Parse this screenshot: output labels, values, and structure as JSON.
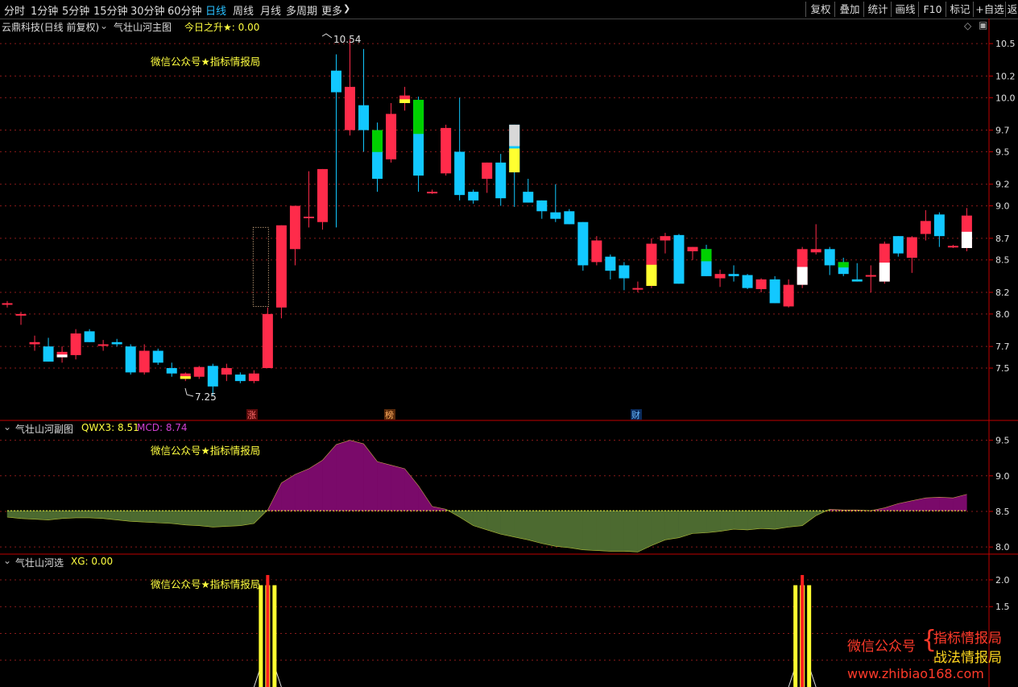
{
  "toolbar": {
    "timeframes": [
      "分时",
      "1分钟",
      "5分钟",
      "15分钟",
      "30分钟",
      "60分钟",
      "日线",
      "周线",
      "月线",
      "多周期",
      "更多"
    ],
    "active": "日线",
    "right_buttons": [
      "复权",
      "叠加",
      "统计",
      "画线",
      "F10",
      "标记",
      "+自选",
      "返"
    ]
  },
  "main_panel": {
    "stock_title": "云鼎科技(日线 前复权)",
    "indicator_name": "气壮山河主图",
    "indicator_value": "今日之升★: 0.00",
    "watermark": "微信公众号★指标情报局",
    "high_label": "10.54",
    "low_label": "7.25",
    "markers": [
      "涨",
      "榜",
      "财"
    ]
  },
  "sub_panel_1": {
    "indicator_name": "气壮山河副图",
    "qwx3": "QWX3: 8.51",
    "mcd": "MCD: 8.74",
    "watermark": "微信公众号★指标情报局"
  },
  "sub_panel_2": {
    "indicator_name": "气壮山河选",
    "xg": "XG: 0.00",
    "watermark": "微信公众号★指标情报局"
  },
  "brand_overlay": {
    "prefix": "微信公众号",
    "line1": "指标情报局",
    "line2": "战法情报局",
    "url": "www.zhibiao168.com"
  },
  "colors": {
    "up": "#ff2b4a",
    "down": "#12c8ff",
    "accent_green": "#00d000",
    "highlight_yellow": "#ffff30",
    "axis_red": "#c00000",
    "purple_area": "#7a0a6a",
    "olive_area": "#4c6a30"
  },
  "chart_data": [
    {
      "type": "candlestick",
      "title": "气壮山河主图",
      "y_axis_ticks": [
        "10.5",
        "10.2",
        "10.0",
        "9.7",
        "9.5",
        "9.2",
        "9.0",
        "8.7",
        "8.5",
        "8.2",
        "8.0",
        "7.7",
        "7.5"
      ],
      "ylim": [
        7.0,
        10.6
      ],
      "candles": [
        {
          "o": 8.1,
          "h": 8.12,
          "l": 8.06,
          "c": 8.1
        },
        {
          "o": 8.0,
          "h": 8.02,
          "l": 7.9,
          "c": 8.0
        },
        {
          "o": 7.72,
          "h": 7.8,
          "l": 7.66,
          "c": 7.74
        },
        {
          "o": 7.7,
          "h": 7.78,
          "l": 7.58,
          "c": 7.56
        },
        {
          "o": 7.6,
          "h": 7.7,
          "l": 7.55,
          "c": 7.65
        },
        {
          "o": 7.62,
          "h": 7.86,
          "l": 7.58,
          "c": 7.82
        },
        {
          "o": 7.84,
          "h": 7.86,
          "l": 7.74,
          "c": 7.74
        },
        {
          "o": 7.72,
          "h": 7.76,
          "l": 7.66,
          "c": 7.72
        },
        {
          "o": 7.74,
          "h": 7.77,
          "l": 7.7,
          "c": 7.72
        },
        {
          "o": 7.7,
          "h": 7.72,
          "l": 7.44,
          "c": 7.46
        },
        {
          "o": 7.46,
          "h": 7.72,
          "l": 7.44,
          "c": 7.66
        },
        {
          "o": 7.66,
          "h": 7.68,
          "l": 7.53,
          "c": 7.55
        },
        {
          "o": 7.5,
          "h": 7.55,
          "l": 7.42,
          "c": 7.45
        },
        {
          "o": 7.4,
          "h": 7.46,
          "l": 7.38,
          "c": 7.45
        },
        {
          "o": 7.42,
          "h": 7.52,
          "l": 7.4,
          "c": 7.51
        },
        {
          "o": 7.52,
          "h": 7.54,
          "l": 7.25,
          "c": 7.33
        },
        {
          "o": 7.44,
          "h": 7.54,
          "l": 7.38,
          "c": 7.5
        },
        {
          "o": 7.44,
          "h": 7.46,
          "l": 7.36,
          "c": 7.38
        },
        {
          "o": 7.38,
          "h": 7.48,
          "l": 7.36,
          "c": 7.45
        },
        {
          "o": 7.5,
          "h": 8.06,
          "l": 7.5,
          "c": 8.0
        },
        {
          "o": 8.06,
          "h": 8.72,
          "l": 7.96,
          "c": 8.82
        },
        {
          "o": 8.6,
          "h": 9.0,
          "l": 8.45,
          "c": 9.0
        },
        {
          "o": 8.9,
          "h": 9.32,
          "l": 8.8,
          "c": 8.9
        },
        {
          "o": 8.85,
          "h": 9.34,
          "l": 8.78,
          "c": 9.34
        },
        {
          "o": 10.25,
          "h": 10.4,
          "l": 8.8,
          "c": 10.05
        },
        {
          "o": 9.7,
          "h": 10.54,
          "l": 9.65,
          "c": 10.1
        },
        {
          "o": 9.93,
          "h": 10.45,
          "l": 9.5,
          "c": 9.7
        },
        {
          "o": 9.7,
          "h": 9.77,
          "l": 9.13,
          "c": 9.25
        },
        {
          "o": 9.43,
          "h": 9.95,
          "l": 9.4,
          "c": 9.85
        },
        {
          "o": 9.95,
          "h": 10.1,
          "l": 9.88,
          "c": 10.02
        },
        {
          "o": 9.98,
          "h": 10.01,
          "l": 9.13,
          "c": 9.28
        },
        {
          "o": 9.13,
          "h": 9.15,
          "l": 9.11,
          "c": 9.13
        },
        {
          "o": 9.3,
          "h": 9.75,
          "l": 9.28,
          "c": 9.72
        },
        {
          "o": 9.5,
          "h": 10.0,
          "l": 9.05,
          "c": 9.1
        },
        {
          "o": 9.13,
          "h": 9.15,
          "l": 9.02,
          "c": 9.05
        },
        {
          "o": 9.25,
          "h": 9.38,
          "l": 9.12,
          "c": 9.4
        },
        {
          "o": 9.4,
          "h": 9.48,
          "l": 9.0,
          "c": 9.07
        },
        {
          "o": 9.75,
          "h": 9.75,
          "l": 8.99,
          "c": 9.31
        },
        {
          "o": 9.13,
          "h": 9.25,
          "l": 9.05,
          "c": 9.03
        },
        {
          "o": 9.05,
          "h": 9.05,
          "l": 8.88,
          "c": 8.95
        },
        {
          "o": 8.94,
          "h": 9.2,
          "l": 8.85,
          "c": 8.88
        },
        {
          "o": 8.95,
          "h": 8.97,
          "l": 8.85,
          "c": 8.83
        },
        {
          "o": 8.85,
          "h": 8.85,
          "l": 8.4,
          "c": 8.45
        },
        {
          "o": 8.48,
          "h": 8.72,
          "l": 8.45,
          "c": 8.68
        },
        {
          "o": 8.53,
          "h": 8.55,
          "l": 8.32,
          "c": 8.4
        },
        {
          "o": 8.45,
          "h": 8.48,
          "l": 8.22,
          "c": 8.33
        },
        {
          "o": 8.24,
          "h": 8.3,
          "l": 8.2,
          "c": 8.24
        },
        {
          "o": 8.26,
          "h": 8.7,
          "l": 8.24,
          "c": 8.65
        },
        {
          "o": 8.68,
          "h": 8.75,
          "l": 8.56,
          "c": 8.72
        },
        {
          "o": 8.73,
          "h": 8.74,
          "l": 8.45,
          "c": 8.28
        },
        {
          "o": 8.58,
          "h": 8.62,
          "l": 8.5,
          "c": 8.62
        },
        {
          "o": 8.6,
          "h": 8.64,
          "l": 8.36,
          "c": 8.35
        },
        {
          "o": 8.33,
          "h": 8.41,
          "l": 8.25,
          "c": 8.37
        },
        {
          "o": 8.37,
          "h": 8.45,
          "l": 8.3,
          "c": 8.35
        },
        {
          "o": 8.36,
          "h": 8.37,
          "l": 8.23,
          "c": 8.24
        },
        {
          "o": 8.23,
          "h": 8.33,
          "l": 8.2,
          "c": 8.32
        },
        {
          "o": 8.32,
          "h": 8.35,
          "l": 8.1,
          "c": 8.1
        },
        {
          "o": 8.07,
          "h": 8.32,
          "l": 8.06,
          "c": 8.27
        },
        {
          "o": 8.27,
          "h": 8.62,
          "l": 8.24,
          "c": 8.6
        },
        {
          "o": 8.57,
          "h": 8.83,
          "l": 8.55,
          "c": 8.6
        },
        {
          "o": 8.6,
          "h": 8.62,
          "l": 8.36,
          "c": 8.45
        },
        {
          "o": 8.48,
          "h": 8.52,
          "l": 8.35,
          "c": 8.37
        },
        {
          "o": 8.32,
          "h": 8.47,
          "l": 8.3,
          "c": 8.3
        },
        {
          "o": 8.36,
          "h": 8.45,
          "l": 8.2,
          "c": 8.36
        },
        {
          "o": 8.3,
          "h": 8.67,
          "l": 8.28,
          "c": 8.65
        },
        {
          "o": 8.72,
          "h": 8.72,
          "l": 8.53,
          "c": 8.56
        },
        {
          "o": 8.52,
          "h": 8.72,
          "l": 8.38,
          "c": 8.71
        },
        {
          "o": 8.74,
          "h": 8.96,
          "l": 8.68,
          "c": 8.86
        },
        {
          "o": 8.92,
          "h": 8.94,
          "l": 8.62,
          "c": 8.72
        },
        {
          "o": 8.62,
          "h": 8.64,
          "l": 8.61,
          "c": 8.63
        },
        {
          "o": 8.61,
          "h": 8.98,
          "l": 8.58,
          "c": 8.91
        }
      ]
    },
    {
      "type": "area",
      "title": "气壮山河副图",
      "y_axis_ticks": [
        "9.5",
        "9.0",
        "8.5",
        "8.0"
      ],
      "ylim": [
        7.9,
        9.62
      ],
      "baseline": 8.51,
      "series": [
        {
          "name": "QWX3",
          "values": [
            8.51
          ]
        },
        {
          "name": "MCD",
          "values": [
            8.42,
            8.4,
            8.39,
            8.38,
            8.4,
            8.41,
            8.41,
            8.4,
            8.38,
            8.36,
            8.35,
            8.34,
            8.33,
            8.31,
            8.3,
            8.28,
            8.29,
            8.3,
            8.33,
            8.52,
            8.9,
            9.02,
            9.1,
            9.22,
            9.44,
            9.5,
            9.45,
            9.2,
            9.15,
            9.1,
            8.86,
            8.57,
            8.53,
            8.42,
            8.3,
            8.24,
            8.18,
            8.14,
            8.1,
            8.05,
            8.01,
            7.99,
            7.96,
            7.95,
            7.94,
            7.94,
            7.93,
            8.02,
            8.1,
            8.13,
            8.19,
            8.2,
            8.22,
            8.25,
            8.24,
            8.26,
            8.25,
            8.28,
            8.3,
            8.44,
            8.53,
            8.52,
            8.52,
            8.51,
            8.55,
            8.61,
            8.65,
            8.69,
            8.7,
            8.69,
            8.74
          ]
        }
      ]
    },
    {
      "type": "bar",
      "title": "气壮山河选",
      "y_axis_ticks": [
        "2.0",
        "1.5"
      ],
      "ylim": [
        0,
        2.2
      ],
      "series": [
        {
          "name": "XG",
          "values": [
            0,
            0,
            0,
            0,
            0,
            0,
            0,
            0,
            0,
            0,
            0,
            0,
            0,
            0,
            0,
            0,
            0,
            0,
            0,
            2,
            0,
            0,
            0,
            0,
            0,
            0,
            0,
            0,
            0,
            0,
            0,
            0,
            0,
            0,
            0,
            0,
            0,
            0,
            0,
            0,
            0,
            0,
            0,
            0,
            0,
            0,
            0,
            0,
            0,
            0,
            0,
            0,
            0,
            0,
            0,
            0,
            0,
            0,
            2,
            0,
            0,
            0,
            0,
            0,
            0,
            0,
            0,
            0,
            0,
            0,
            0
          ]
        }
      ]
    }
  ]
}
